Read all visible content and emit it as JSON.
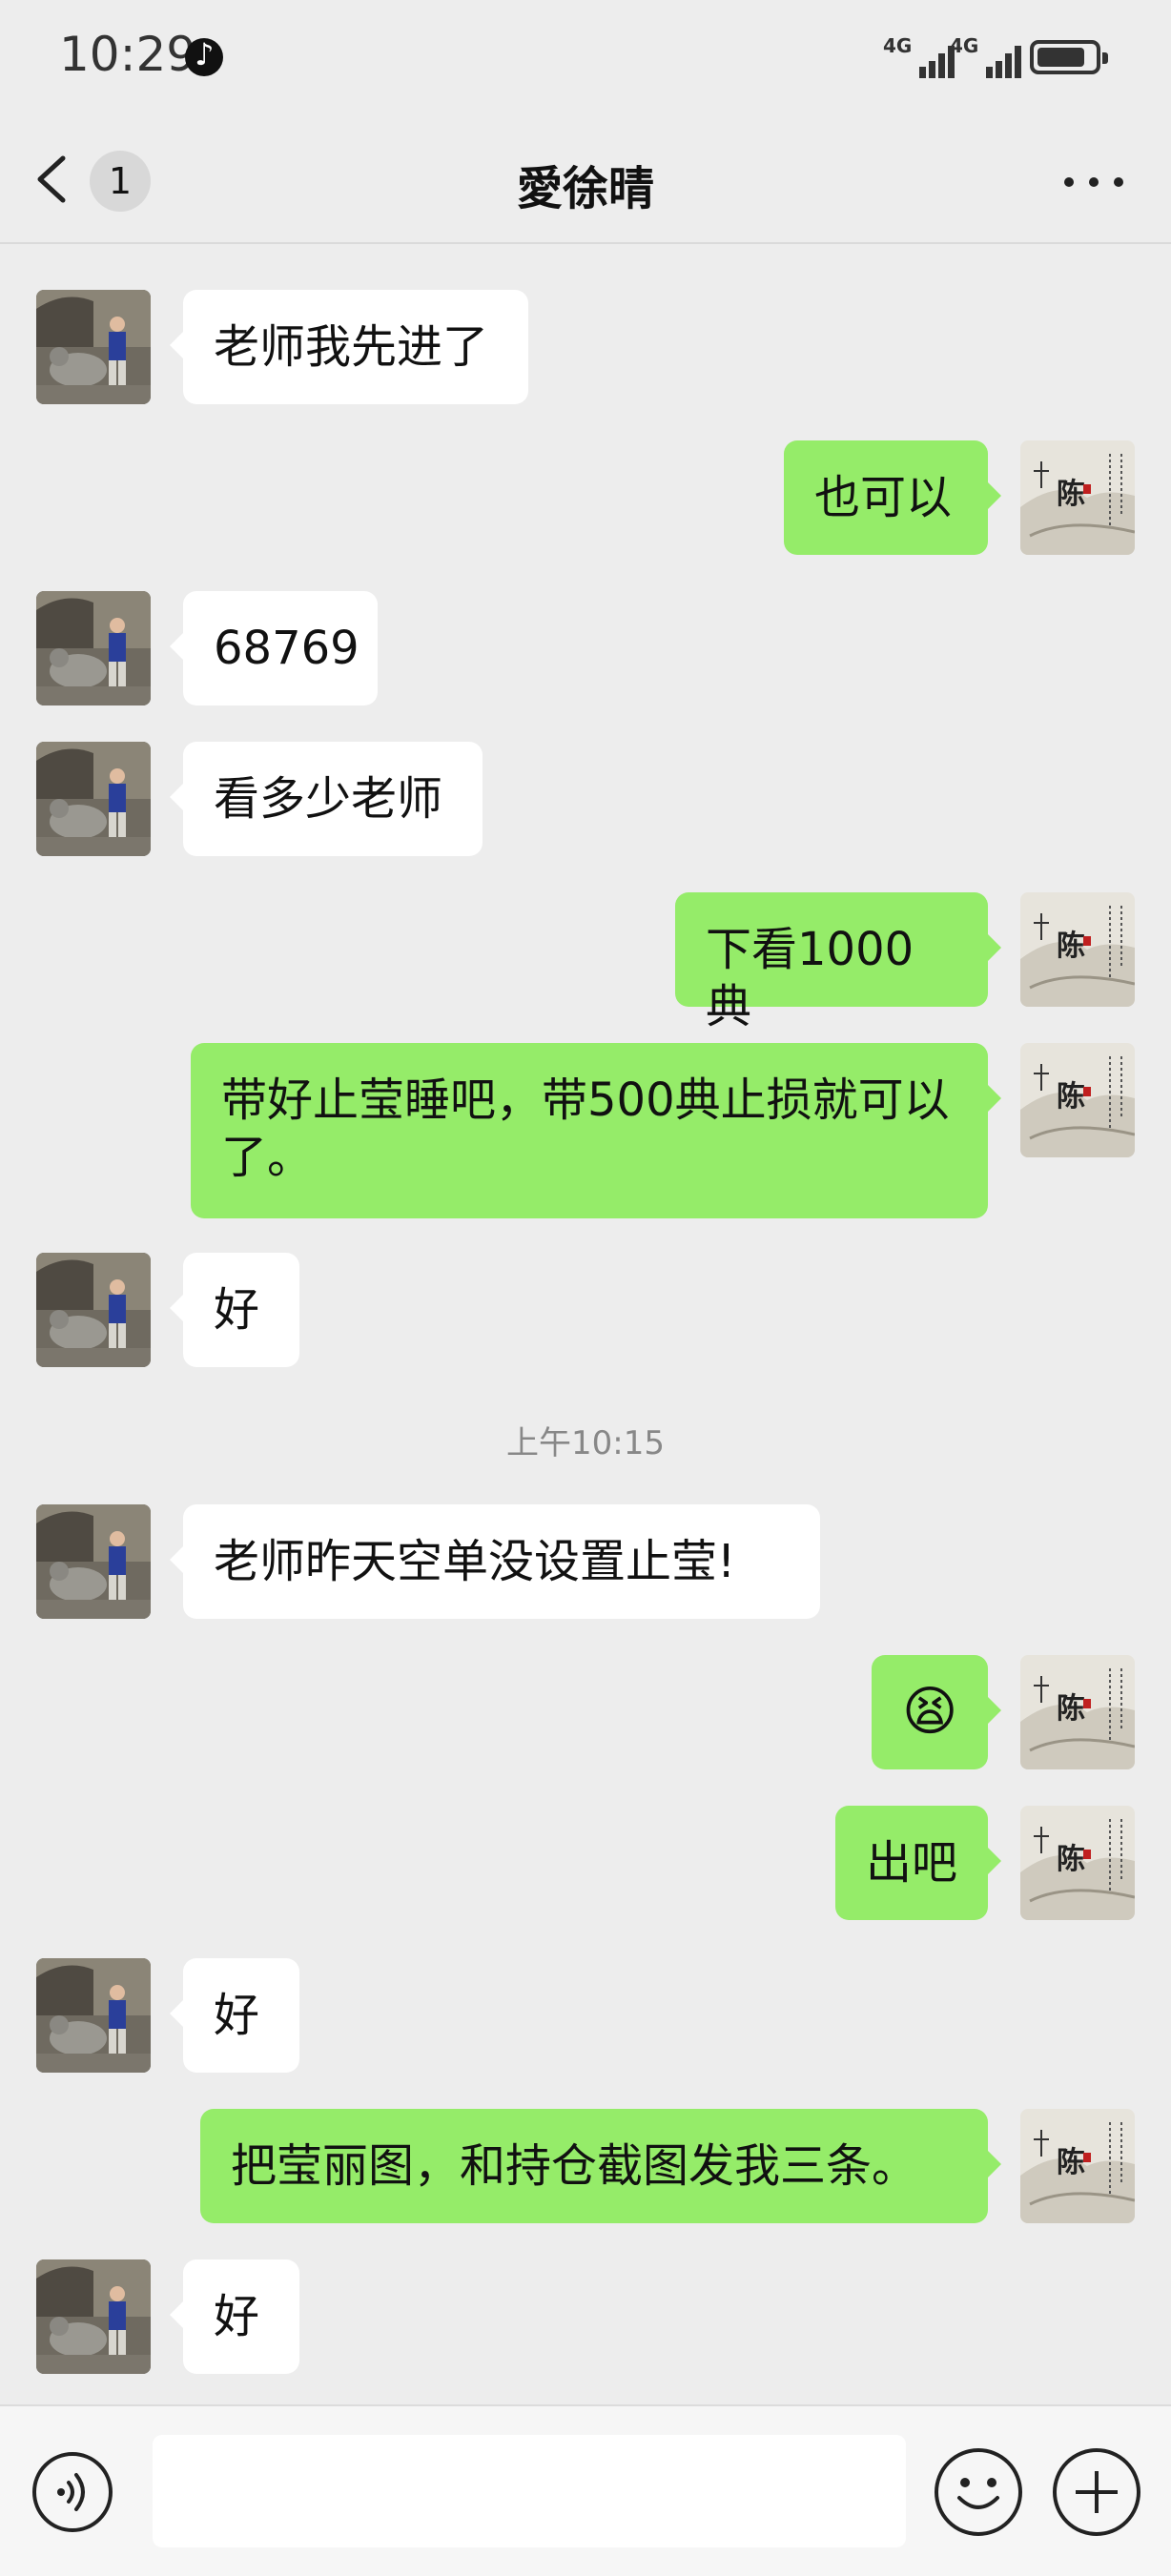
{
  "status_bar": {
    "time": "10:29",
    "app_icon": "tiktok-icon",
    "signal_1_label": "4G",
    "signal_2_label": "4G",
    "battery_level": 0.85
  },
  "header": {
    "unread_count": "1",
    "title": "愛徐晴",
    "back_icon": "chevron-left-icon",
    "more_icon": "more-dots-icon"
  },
  "messages": [
    {
      "side": "left",
      "text": "老师我先进了"
    },
    {
      "side": "right",
      "text": "也可以"
    },
    {
      "side": "left",
      "text": "68769"
    },
    {
      "side": "left",
      "text": "看多少老师"
    },
    {
      "side": "right",
      "text": "下看1000典"
    },
    {
      "side": "right",
      "text": "带好止莹睡吧，带500典止损就可以了。"
    },
    {
      "side": "left",
      "text": "好"
    },
    {
      "type": "timestamp",
      "text": "上午10:15"
    },
    {
      "side": "left",
      "text": "老师昨天空单没设置止莹!"
    },
    {
      "side": "right",
      "text": "😫",
      "kind": "emoji"
    },
    {
      "side": "right",
      "text": "出吧"
    },
    {
      "side": "left",
      "text": "好"
    },
    {
      "side": "right",
      "text": "把莹丽图，和持仓截图发我三条。"
    },
    {
      "side": "left",
      "text": "好"
    }
  ],
  "colors": {
    "background": "#ededed",
    "bubble_left": "#ffffff",
    "bubble_right": "#95ec69"
  },
  "input_bar": {
    "voice_icon": "voice-icon",
    "emoji_icon": "emoji-icon",
    "plus_icon": "plus-icon",
    "value": ""
  }
}
